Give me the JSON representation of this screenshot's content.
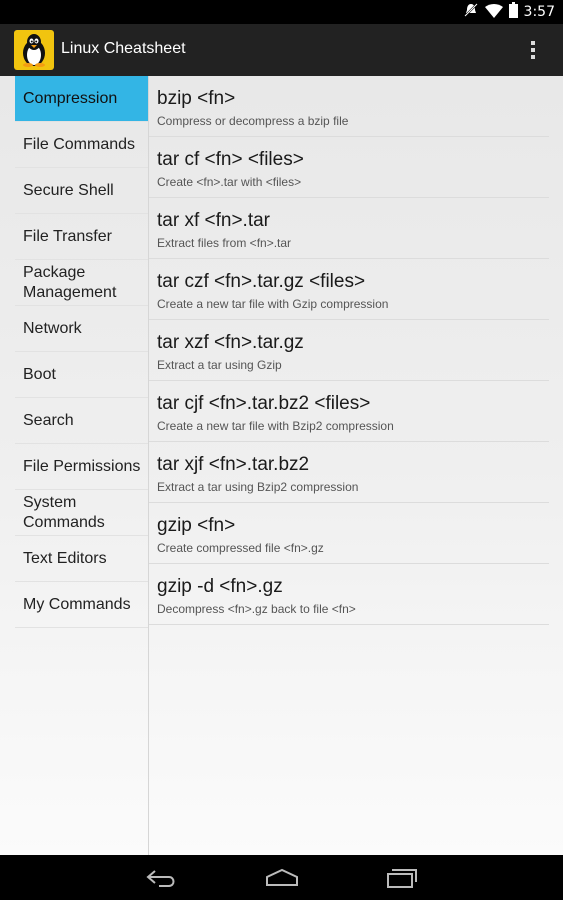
{
  "status": {
    "time": "3:57"
  },
  "app": {
    "title": "Linux Cheatsheet"
  },
  "sidebar": {
    "items": [
      {
        "label": "Compression",
        "active": true
      },
      {
        "label": "File Commands"
      },
      {
        "label": "Secure Shell"
      },
      {
        "label": "File Transfer"
      },
      {
        "label": "Package Management"
      },
      {
        "label": "Network"
      },
      {
        "label": "Boot"
      },
      {
        "label": "Search"
      },
      {
        "label": "File Permissions"
      },
      {
        "label": "System Commands"
      },
      {
        "label": "Text Editors"
      },
      {
        "label": "My Commands"
      }
    ]
  },
  "commands": [
    {
      "title": "bzip <fn>",
      "desc": "Compress or decompress a bzip file"
    },
    {
      "title": "tar cf <fn> <files>",
      "desc": "Create <fn>.tar with <files>"
    },
    {
      "title": "tar xf <fn>.tar",
      "desc": "Extract files from <fn>.tar"
    },
    {
      "title": "tar czf <fn>.tar.gz <files>",
      "desc": "Create a new tar file with Gzip compression"
    },
    {
      "title": "tar xzf <fn>.tar.gz",
      "desc": "Extract a tar using Gzip"
    },
    {
      "title": "tar cjf <fn>.tar.bz2 <files>",
      "desc": "Create a new tar file with Bzip2 compression"
    },
    {
      "title": "tar xjf <fn>.tar.bz2",
      "desc": "Extract a tar using Bzip2 compression"
    },
    {
      "title": "gzip <fn>",
      "desc": "Create compressed file <fn>.gz"
    },
    {
      "title": "gzip -d <fn>.gz",
      "desc": "Decompress <fn>.gz back to file <fn>"
    }
  ],
  "icons": {
    "status": [
      "notification-muted-icon",
      "wifi-icon",
      "battery-icon"
    ],
    "nav": [
      "back-icon",
      "home-icon",
      "recent-apps-icon"
    ]
  },
  "colors": {
    "accent": "#33b5e5",
    "app_icon_bg": "#f1c40f",
    "action_bar": "#222222"
  }
}
